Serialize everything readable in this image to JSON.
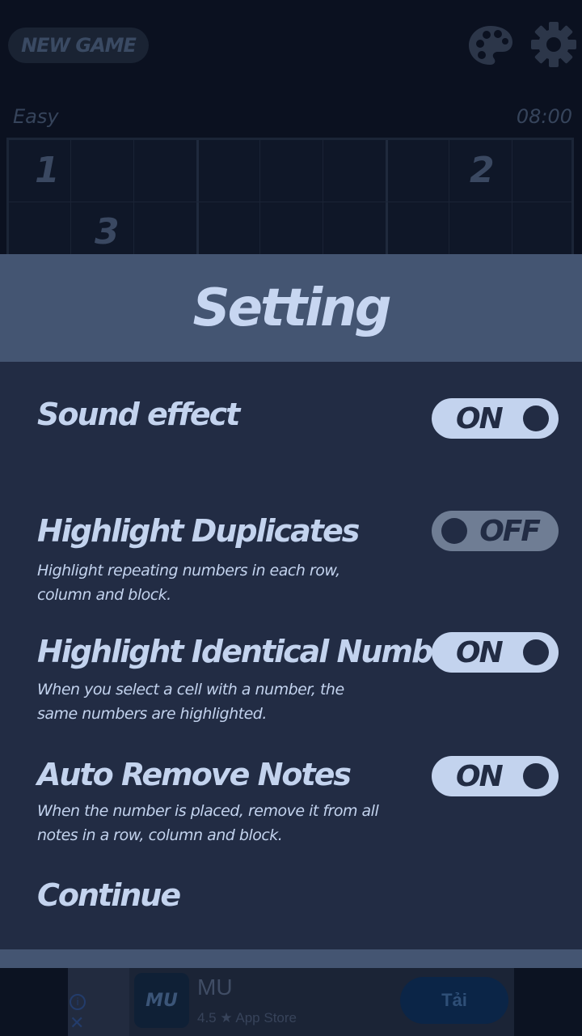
{
  "background": {
    "new_game_label": "NEW GAME",
    "difficulty": "Easy",
    "timer": "08:00",
    "visible_cells": [
      "1",
      "2",
      "3"
    ]
  },
  "settings_modal": {
    "title": "Setting",
    "items": [
      {
        "title": "Sound effect",
        "description": "",
        "state": "ON"
      },
      {
        "title": "Highlight Duplicates",
        "description": "Highlight repeating numbers in each row, column and block.",
        "state": "OFF"
      },
      {
        "title": "Highlight Identical Numbers",
        "description": "When you select a cell with a number, the same numbers are highlighted.",
        "state": "ON"
      },
      {
        "title": "Auto Remove Notes",
        "description": "When the number is placed, remove it from all notes in a row, column and block.",
        "state": "ON"
      }
    ],
    "continue_label": "Continue"
  },
  "ad": {
    "icon_text": "MU",
    "app_name": "MU",
    "rating_line": "4.5 ★ App Store",
    "button_label": "Tải"
  },
  "colors": {
    "accent": "#c3d3ee",
    "modal_header": "#445572",
    "modal_body": "#222c44"
  }
}
